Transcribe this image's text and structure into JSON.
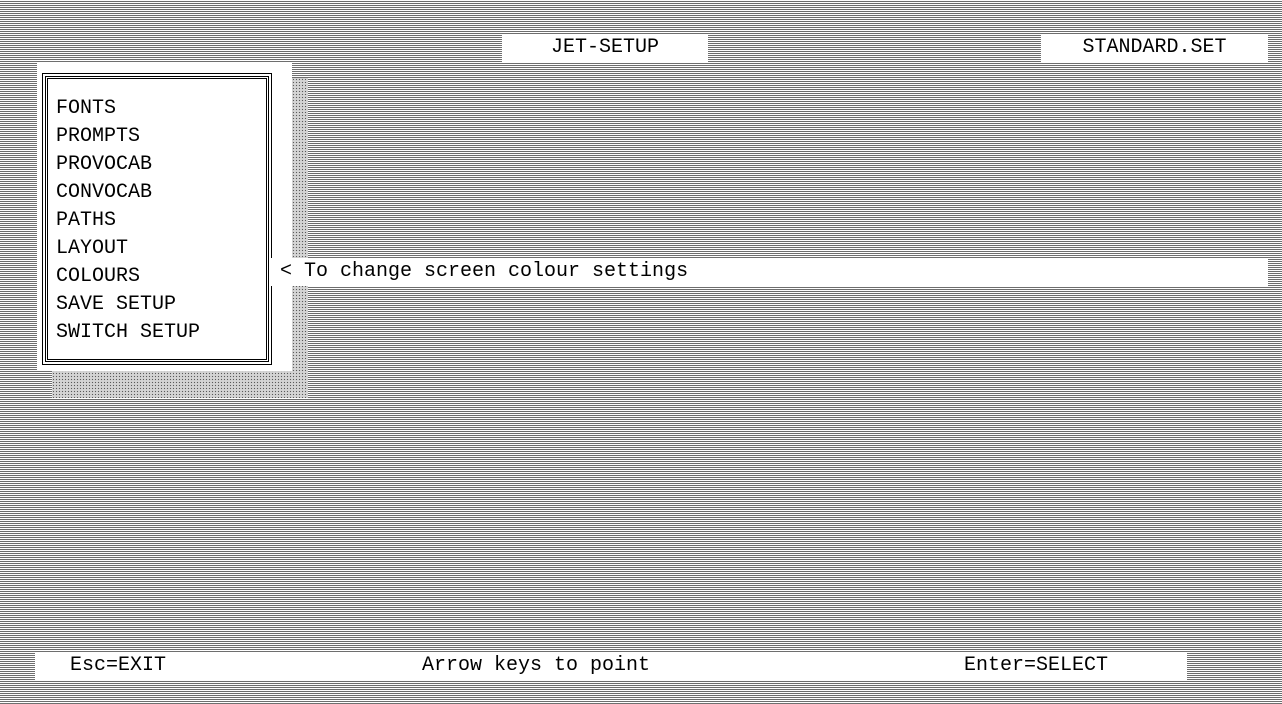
{
  "header": {
    "app_title": "JET-SETUP",
    "file_name": "STANDARD.SET"
  },
  "menu": {
    "items": [
      {
        "label": "FONTS"
      },
      {
        "label": "PROMPTS"
      },
      {
        "label": "PROVOCAB"
      },
      {
        "label": "CONVOCAB"
      },
      {
        "label": "PATHS"
      },
      {
        "label": "LAYOUT"
      },
      {
        "label": "COLOURS"
      },
      {
        "label": "SAVE SETUP"
      },
      {
        "label": "SWITCH SETUP"
      }
    ],
    "selected": "COLOURS"
  },
  "help": {
    "text": "< To change screen colour settings"
  },
  "footer": {
    "esc_hint": "Esc=EXIT",
    "arrow_hint": "Arrow keys to point",
    "enter_hint": "Enter=SELECT"
  }
}
